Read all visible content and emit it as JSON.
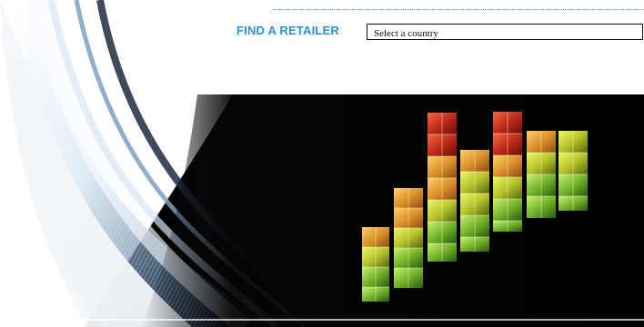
{
  "header": {
    "find_retailer_label": "FIND A RETAILER",
    "country_select": {
      "selected": "Select a country"
    }
  },
  "colors": {
    "accent_blue": "#2a91d8",
    "dotted_rule": "#5b8fc8",
    "hero_black": "#050505"
  },
  "hero": {
    "image_name": "3d-cube-equalizer-with-wave-lines"
  }
}
